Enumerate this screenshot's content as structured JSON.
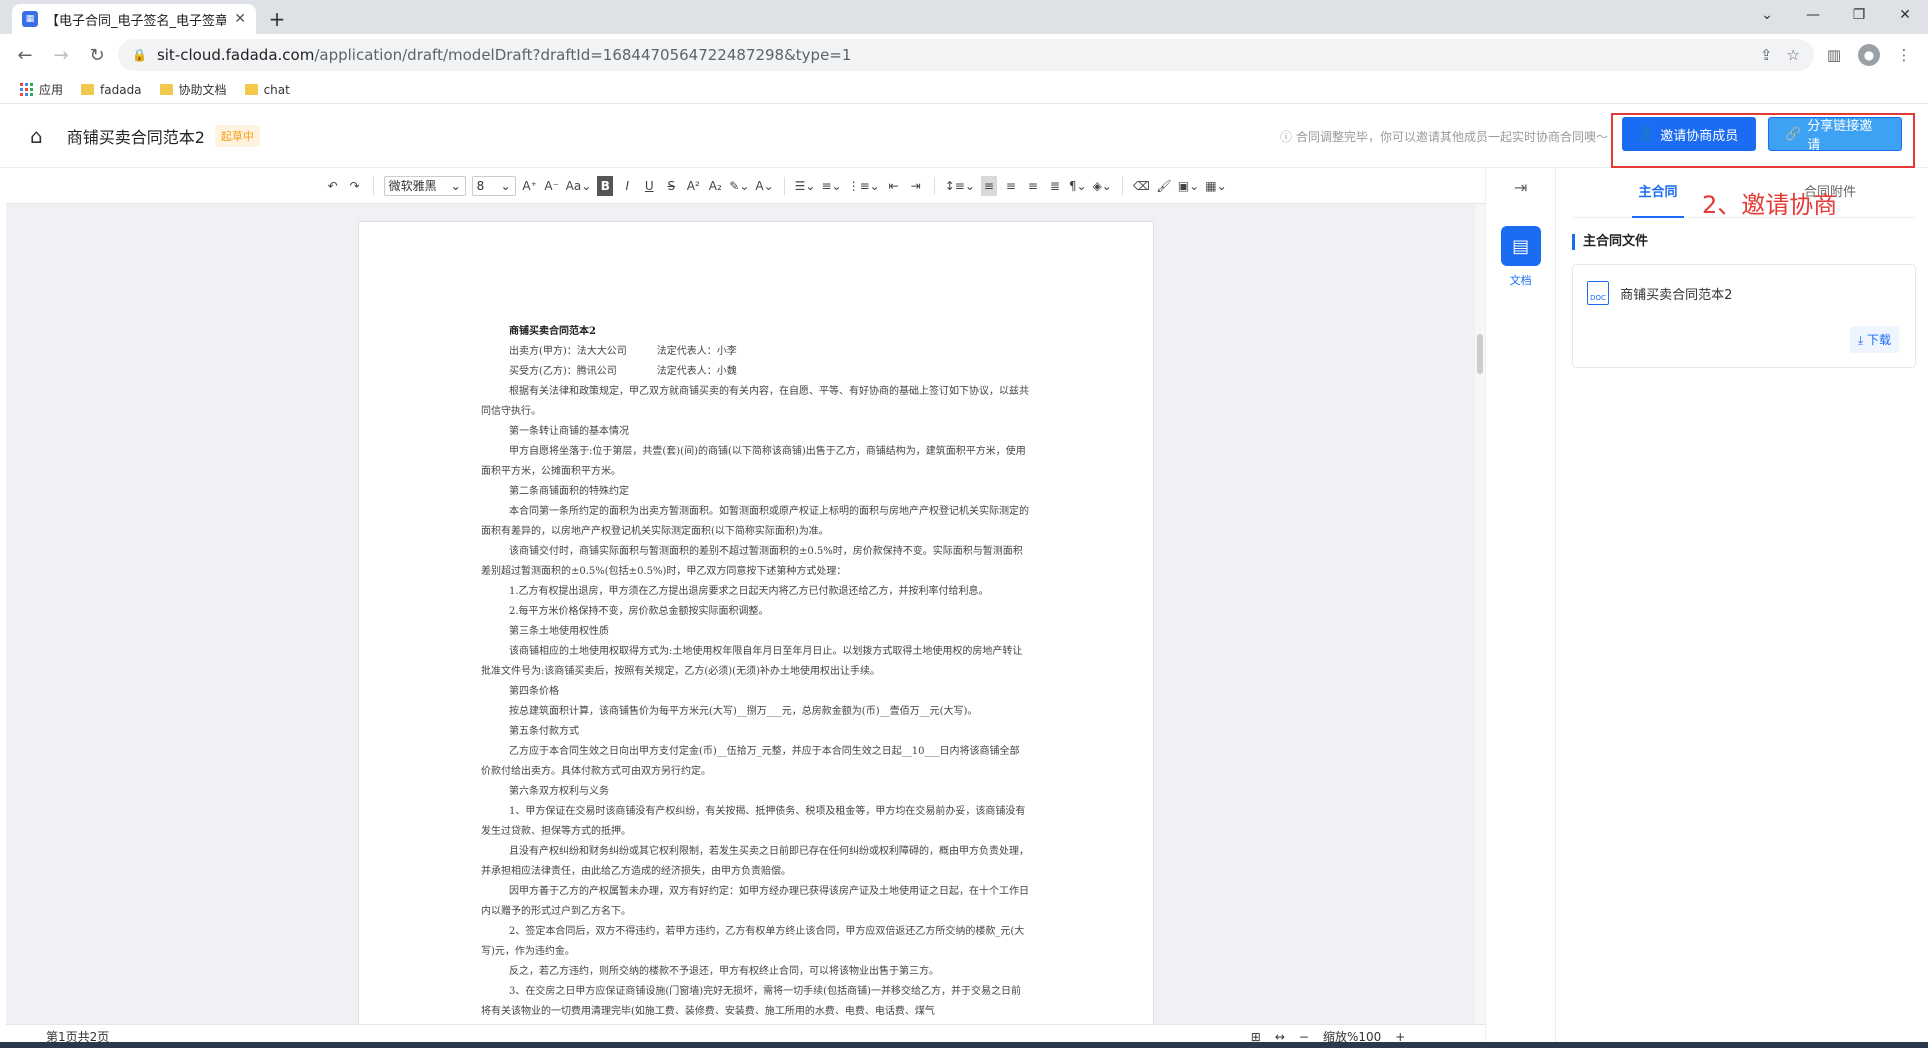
{
  "browser": {
    "tab_title": "【电子合同_电子签名_电子签章】",
    "url_host": "sit-cloud.fadada.com",
    "url_path": "/application/draft/modelDraft?draftId=1684470564722487298&type=1",
    "bookmarks": [
      "应用",
      "fadada",
      "协助文档",
      "chat"
    ]
  },
  "header": {
    "doc_title": "商铺买卖合同范本2",
    "status_badge": "起草中",
    "hint": "合同调整完毕，你可以邀请其他成员一起实时协商合同噢～",
    "invite_button": "邀请协商成员",
    "share_button": "分享链接邀请",
    "annotation": "2、邀请协商"
  },
  "toolbar": {
    "font_family": "微软雅黑",
    "font_size": "8"
  },
  "document": {
    "lines": [
      {
        "cls": "ptitle",
        "text": "商铺买卖合同范本2"
      },
      {
        "cls": "indent",
        "text": "出卖方(甲方)：法大大公司　　　法定代表人：小李"
      },
      {
        "cls": "indent",
        "text": "买受方(乙方)：腾讯公司　　　　法定代表人：小魏"
      },
      {
        "cls": "indent",
        "text": "根据有关法律和政策规定，甲乙双方就商铺买卖的有关内容，在自愿、平等、有好协商的基础上签订如下协议，以兹共同信守执行。"
      },
      {
        "cls": "indent",
        "text": "第一条转让商铺的基本情况"
      },
      {
        "cls": "indent",
        "text": "甲方自愿将坐落于:位于第层，共壹(套)(间)的商铺(以下简称该商铺)出售于乙方，商铺结构为，建筑面积平方米，使用面积平方米，公摊面积平方米。"
      },
      {
        "cls": "indent",
        "text": "第二条商铺面积的特殊约定"
      },
      {
        "cls": "indent",
        "text": "本合同第一条所约定的面积为出卖方暂测面积。如暂测面积或原产权证上标明的面积与房地产产权登记机关实际测定的面积有差异的，以房地产产权登记机关实际测定面积(以下简称实际面积)为准。"
      },
      {
        "cls": "indent",
        "text": "该商铺交付时，商铺实际面积与暂测面积的差别不超过暂测面积的±0.5%时，房价款保持不变。实际面积与暂测面积差别超过暂测面积的±0.5%(包括±0.5%)时，甲乙双方同意按下述第种方式处理："
      },
      {
        "cls": "indent",
        "text": "1.乙方有权提出退房，甲方须在乙方提出退房要求之日起天内将乙方已付款退还给乙方，并按利率付给利息。"
      },
      {
        "cls": "indent",
        "text": "2.每平方米价格保持不变，房价款总金额按实际面积调整。"
      },
      {
        "cls": "indent",
        "text": "第三条土地使用权性质"
      },
      {
        "cls": "indent",
        "text": "该商铺相应的土地使用权取得方式为:土地使用权年限自年月日至年月日止。以划拨方式取得土地使用权的房地产转让批准文件号为:该商铺买卖后，按照有关规定，乙方(必须)(无须)补办土地使用权出让手续。"
      },
      {
        "cls": "indent",
        "text": "第四条价格"
      },
      {
        "cls": "indent",
        "text": "按总建筑面积计算，该商铺售价为每平方米元(大写)__捌万___元，总房款金额为(币)__壹佰万__元(大写)。"
      },
      {
        "cls": "indent",
        "text": "第五条付款方式"
      },
      {
        "cls": "indent",
        "text": "乙方应于本合同生效之日向出甲方支付定金(币)__伍拾万_元整，并应于本合同生效之日起__10___日内将该商铺全部价款付给出卖方。具体付款方式可由双方另行约定。"
      },
      {
        "cls": "indent",
        "text": "第六条双方权利与义务"
      },
      {
        "cls": "indent",
        "text": "1、甲方保证在交易时该商铺没有产权纠纷，有关按揭、抵押债务、税项及租金等，甲方均在交易前办妥，该商铺没有发生过贷款、担保等方式的抵押。"
      },
      {
        "cls": "indent",
        "text": "且没有产权纠纷和财务纠纷或其它权利限制，若发生买卖之日前即已存在任何纠纷或权利障碍的，概由甲方负责处理，并承担相应法律责任，由此给乙方造成的经济损失，由甲方负责赔偿。"
      },
      {
        "cls": "indent",
        "text": "因甲方善于乙方的产权属暂未办理，双方有好约定：如甲方经办理已获得该房产证及土地使用证之日起，在十个工作日内以赠予的形式过户到乙方名下。"
      },
      {
        "cls": "indent",
        "text": "2、签定本合同后，双方不得违约，若甲方违约，乙方有权单方终止该合同，甲方应双倍返还乙方所交纳的楼款_元(大写)元，作为违约金。"
      },
      {
        "cls": "indent",
        "text": "反之，若乙方违约，则所交纳的楼款不予退还，甲方有权终止合同，可以将该物业出售于第三方。"
      },
      {
        "cls": "indent",
        "text": "3、在交房之日甲方应保证商铺设施(门窗墙)完好无损坏，需将一切手续(包括商铺)一并移交给乙方，并于交易之日前将有关该物业的一切费用清理完毕(如施工费、装修费、安装费、施工所用的水费、电费、电话费、煤气"
      }
    ]
  },
  "statusbar": {
    "pages": "第1页共2页",
    "zoom": "缩放%100"
  },
  "sidepanel": {
    "rail_label": "文档",
    "tabs": [
      "主合同",
      "合同附件"
    ],
    "section_title": "主合同文件",
    "file_name": "商铺买卖合同范本2",
    "file_icon_text": "DOC",
    "download_label": "下载"
  }
}
